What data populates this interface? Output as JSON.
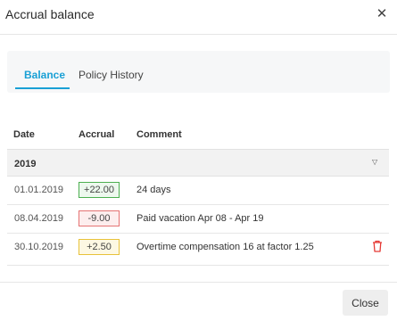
{
  "dialog": {
    "title": "Accrual balance",
    "close_icon": "close-icon"
  },
  "tabs": [
    {
      "label": "Balance",
      "active": true
    },
    {
      "label": "Policy History",
      "active": false
    }
  ],
  "table": {
    "columns": [
      "Date",
      "Accrual",
      "Comment"
    ],
    "groups": [
      {
        "year": "2019",
        "rows": [
          {
            "date": "01.01.2019",
            "accrual": "+22.00",
            "accrual_type": "positive",
            "comment": "24 days",
            "deletable": false
          },
          {
            "date": "08.04.2019",
            "accrual": "-9.00",
            "accrual_type": "negative",
            "comment": "Paid vacation Apr 08 - Apr 19",
            "deletable": false
          },
          {
            "date": "30.10.2019",
            "accrual": "+2.50",
            "accrual_type": "adjustment",
            "comment": "Overtime compensation 16 at factor 1.25",
            "deletable": true
          }
        ]
      }
    ]
  },
  "colors": {
    "accent": "#19a0d5",
    "positive": "#4caf50",
    "negative": "#e57373",
    "adjustment": "#e8c23a",
    "delete": "#e53935"
  },
  "footer": {
    "close_label": "Close"
  }
}
